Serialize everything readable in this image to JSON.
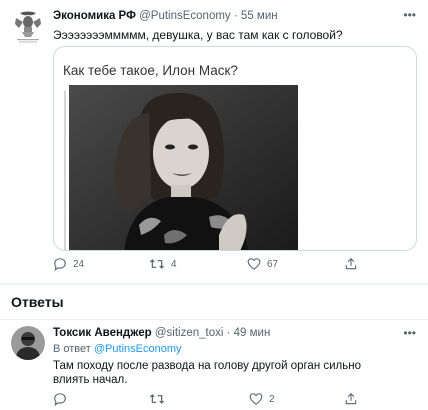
{
  "tweet": {
    "author_name": "Экономика РФ",
    "handle": "@PutinsEconomy",
    "separator": "·",
    "time": "55 мин",
    "text": "Ээээээээммммм, девушка, у вас там как с головой?",
    "quote_title": "Как тебе такое, Илон Маск?",
    "more_label": "•••",
    "reply_count": "24",
    "retweet_count": "4",
    "like_count": "67"
  },
  "answers": {
    "header": "Ответы"
  },
  "reply": {
    "author_name": "Токсик Авенджер",
    "handle": "@sitizen_toxi",
    "separator": "·",
    "time": "49 мин",
    "in_reply_prefix": "В ответ",
    "in_reply_mention": "@PutinsEconomy",
    "text": "Там походу после развода на голову другой орган сильно  влиять начал.",
    "more_label": "•••",
    "reply_count": "",
    "retweet_count": "",
    "like_count": "2"
  },
  "colors": {
    "accent": "#1d9bf0",
    "secondary_text": "#536471",
    "border": "#cfd9de"
  },
  "icons": [
    "emblem-avatar",
    "reply-icon",
    "retweet-icon",
    "like-icon",
    "share-icon",
    "more-icon"
  ]
}
